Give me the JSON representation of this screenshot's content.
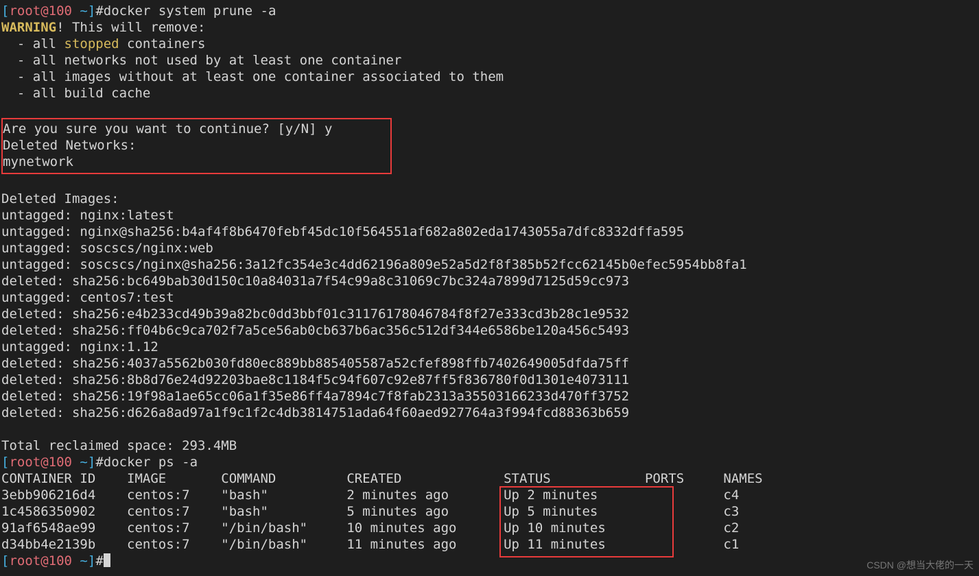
{
  "prompt1": {
    "bracket_open": "[",
    "user": "root@100",
    "space": " ",
    "tilde": "~",
    "bracket_close": "]",
    "hash": "#"
  },
  "cmd1": "docker system prune -a",
  "warning_label": "WARNING",
  "warning_rest": "! This will remove:",
  "remove_list": [
    "  - all ",
    "  - all networks not used by at least one container",
    "  - all images without at least one container associated to them",
    "  - all build cache"
  ],
  "stopped_hi": "stopped",
  "stopped_rest": " containers",
  "confirm_block": {
    "l1": "Are you sure you want to continue? [y/N] y",
    "l2": "Deleted Networks:",
    "l3": "mynetwork"
  },
  "deleted_images_header": "Deleted Images:",
  "deleted_images": [
    "untagged: nginx:latest",
    "untagged: nginx@sha256:b4af4f8b6470febf45dc10f564551af682a802eda1743055a7dfc8332dffa595",
    "untagged: soscscs/nginx:web",
    "untagged: soscscs/nginx@sha256:3a12fc354e3c4dd62196a809e52a5d2f8f385b52fcc62145b0efec5954bb8fa1",
    "deleted: sha256:bc649bab30d150c10a84031a7f54c99a8c31069c7bc324a7899d7125d59cc973",
    "untagged: centos7:test",
    "deleted: sha256:e4b233cd49b39a82bc0dd3bbf01c31176178046784f8f27e333cd3b28c1e9532",
    "deleted: sha256:ff04b6c9ca702f7a5ce56ab0cb637b6ac356c512df344e6586be120a456c5493",
    "untagged: nginx:1.12",
    "deleted: sha256:4037a5562b030fd80ec889bb885405587a52cfef898ffb7402649005dfda75ff",
    "deleted: sha256:8b8d76e24d92203bae8c1184f5c94f607c92e87ff5f836780f0d1301e4073111",
    "deleted: sha256:19f98a1ae65cc06a1f35e86ff4a7894c7f8fab2313a35503166233d470ff3752",
    "deleted: sha256:d626a8ad97a1f9c1f2c4db3814751ada64f60aed927764a3f994fcd88363b659"
  ],
  "total_reclaimed": "Total reclaimed space: 293.4MB",
  "cmd2": "docker ps -a",
  "ps_header": {
    "id": "CONTAINER ID",
    "image": "IMAGE",
    "command": "COMMAND",
    "created": "CREATED",
    "status": "STATUS",
    "ports": "PORTS",
    "names": "NAMES"
  },
  "ps_rows": [
    {
      "id": "3ebb906216d4",
      "image": "centos:7",
      "command": "\"bash\"",
      "created": "2 minutes ago",
      "status": "Up 2 minutes",
      "ports": "",
      "names": "c4"
    },
    {
      "id": "1c4586350902",
      "image": "centos:7",
      "command": "\"bash\"",
      "created": "5 minutes ago",
      "status": "Up 5 minutes",
      "ports": "",
      "names": "c3"
    },
    {
      "id": "91af6548ae99",
      "image": "centos:7",
      "command": "\"/bin/bash\"",
      "created": "10 minutes ago",
      "status": "Up 10 minutes",
      "ports": "",
      "names": "c2"
    },
    {
      "id": "d34bb4e2139b",
      "image": "centos:7",
      "command": "\"/bin/bash\"",
      "created": "11 minutes ago",
      "status": "Up 11 minutes",
      "ports": "",
      "names": "c1"
    }
  ],
  "watermark": "CSDN @想当大佬的一天"
}
